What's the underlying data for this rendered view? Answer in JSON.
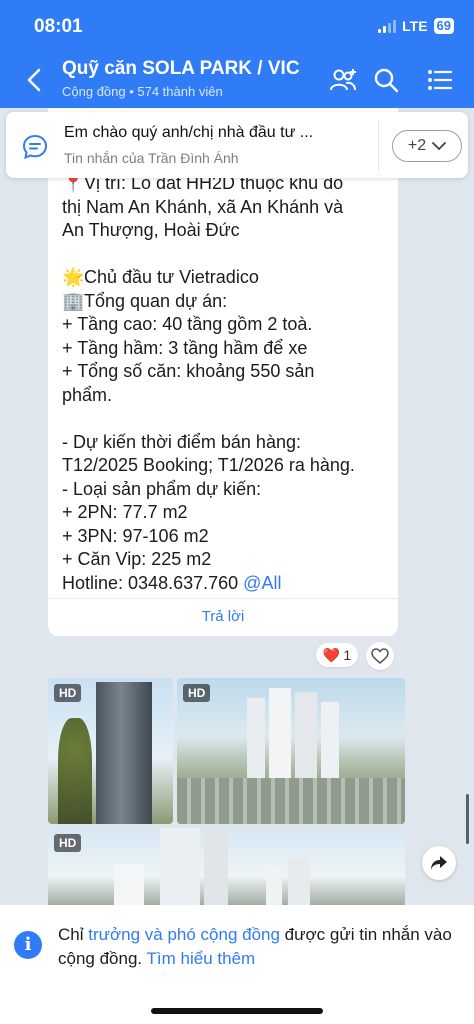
{
  "status_bar": {
    "time": "08:01",
    "network": "LTE",
    "battery": "69"
  },
  "header": {
    "title": "Quỹ căn SOLA PARK / VIC",
    "subtitle": "Cộng đồng • 574 thành viên",
    "icons": [
      "back-arrow-icon",
      "group-add-icon",
      "search-icon",
      "menu-icon"
    ]
  },
  "pinned": {
    "text": "Em chào quý anh/chị nhà đầu tư ...",
    "sender": "Tin nhắn của Trần Đình Ánh",
    "more_label": "+2"
  },
  "message": {
    "lines": [
      {
        "emoji": "📍",
        "text": "Vị trí: Lô đất HH2D thuộc khu đô"
      },
      {
        "emoji": "",
        "text": "thị Nam An Khánh, xã An Khánh và"
      },
      {
        "emoji": "",
        "text": "An Thượng,  Hoài Đức"
      },
      {
        "emoji": "",
        "text": ""
      },
      {
        "emoji": "🌟",
        "text": "Chủ đầu tư Vietradico"
      },
      {
        "emoji": "🏢",
        "text": "Tổng quan dự án:"
      },
      {
        "emoji": "",
        "text": "+ Tầng cao: 40 tầng gồm 2 toà."
      },
      {
        "emoji": "",
        "text": "+ Tầng hầm: 3 tầng hầm để xe"
      },
      {
        "emoji": "",
        "text": "+ Tổng số căn: khoảng 550 sản"
      },
      {
        "emoji": "",
        "text": "phẩm."
      },
      {
        "emoji": "",
        "text": ""
      },
      {
        "emoji": "",
        "text": "- Dự kiến thời điểm bán hàng:"
      },
      {
        "emoji": "",
        "text": "T12/2025 Booking; T1/2026 ra hàng."
      },
      {
        "emoji": "",
        "text": "- Loại sản phẩm dự kiến:"
      },
      {
        "emoji": "",
        "text": "+ 2PN: 77.7 m2"
      },
      {
        "emoji": "",
        "text": "+ 3PN: 97-106 m2"
      },
      {
        "emoji": "",
        "text": "+ Căn Vip: 225 m2"
      }
    ],
    "hotline": "Hotline: 0348.637.760",
    "mention": "@All",
    "reply_label": "Trả lời",
    "reaction_emoji": "❤️",
    "reaction_count": "1"
  },
  "images": [
    {
      "badge": "HD"
    },
    {
      "badge": "HD"
    },
    {
      "badge": "HD"
    }
  ],
  "notice": {
    "prefix": "Chỉ ",
    "link1": "trưởng và phó cộng đồng",
    "middle": " được gửi tin nhắn vào cộng đồng. ",
    "link2": "Tìm hiểu thêm"
  },
  "colors": {
    "accent": "#2f7cf6",
    "chat_background": "#dfe6ee"
  }
}
